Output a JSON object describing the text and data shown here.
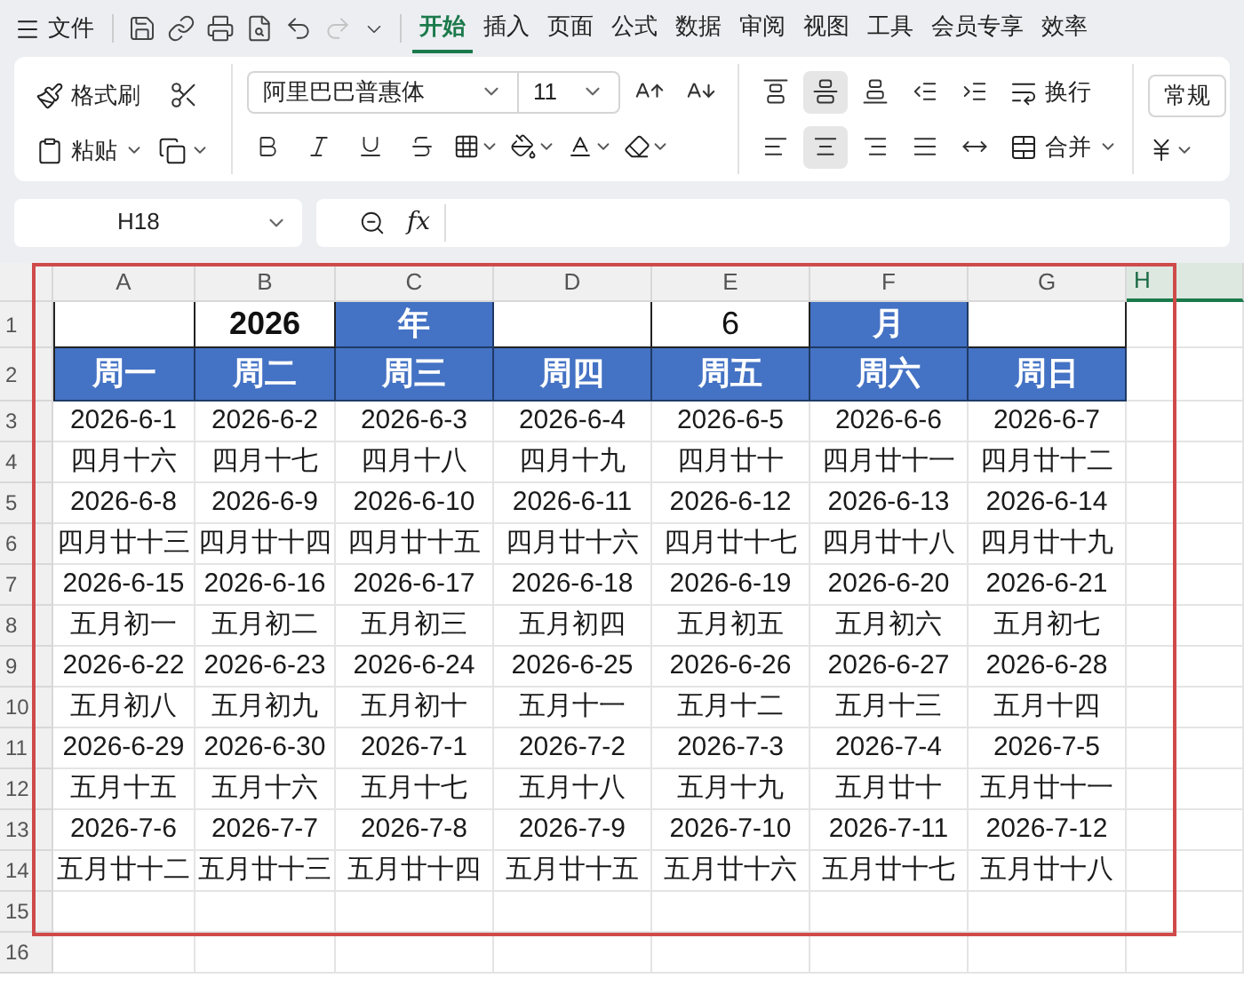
{
  "menu_bar": {
    "file_label": "文件",
    "quick_access": [
      {
        "kind": "save",
        "disabled": false
      },
      {
        "kind": "link",
        "disabled": false
      },
      {
        "kind": "print",
        "disabled": false
      },
      {
        "kind": "preview",
        "disabled": false
      },
      {
        "kind": "undo",
        "disabled": false
      },
      {
        "kind": "redo",
        "disabled": true
      },
      {
        "kind": "more",
        "disabled": false
      }
    ],
    "tabs": [
      {
        "label": "开始",
        "selected": true
      },
      {
        "label": "插入",
        "selected": false
      },
      {
        "label": "页面",
        "selected": false
      },
      {
        "label": "公式",
        "selected": false
      },
      {
        "label": "数据",
        "selected": false
      },
      {
        "label": "审阅",
        "selected": false
      },
      {
        "label": "视图",
        "selected": false
      },
      {
        "label": "工具",
        "selected": false
      },
      {
        "label": "会员专享",
        "selected": false
      },
      {
        "label": "效率",
        "selected": false
      }
    ]
  },
  "ribbon": {
    "format_painter": "格式刷",
    "paste": "粘贴",
    "font_name": "阿里巴巴普惠体",
    "font_size": "11",
    "wrap": "换行",
    "merge": "合并",
    "number_format": "常规",
    "vertical_align": [
      {
        "kind": "top",
        "selected": false
      },
      {
        "kind": "middle",
        "selected": true
      },
      {
        "kind": "bottom",
        "selected": false
      },
      {
        "kind": "outdent",
        "selected": false
      },
      {
        "kind": "indent",
        "selected": false
      }
    ],
    "horizontal_align": [
      {
        "kind": "left",
        "selected": false
      },
      {
        "kind": "center",
        "selected": true
      },
      {
        "kind": "right",
        "selected": false
      },
      {
        "kind": "justify",
        "selected": false
      },
      {
        "kind": "distributed",
        "selected": false
      }
    ]
  },
  "formula_bar": {
    "cell_ref": "H18",
    "fx": "fx"
  },
  "sheet": {
    "columns": [
      {
        "label": "A",
        "selected": false
      },
      {
        "label": "B",
        "selected": false
      },
      {
        "label": "C",
        "selected": false
      },
      {
        "label": "D",
        "selected": false
      },
      {
        "label": "E",
        "selected": false
      },
      {
        "label": "F",
        "selected": false
      },
      {
        "label": "G",
        "selected": false
      },
      {
        "label": "H",
        "selected": true
      }
    ],
    "row_numbers": [
      "1",
      "2",
      "3",
      "4",
      "5",
      "6",
      "7",
      "8",
      "9",
      "10",
      "11",
      "12",
      "13",
      "14",
      "15",
      "16"
    ],
    "rows": [
      [
        {
          "kind": "input"
        },
        {
          "kind": "input",
          "text": "2026",
          "bold": true
        },
        {
          "kind": "header",
          "text": "年"
        },
        {
          "kind": "input"
        },
        {
          "kind": "input",
          "text": "6",
          "bold": false
        },
        {
          "kind": "header",
          "text": "月"
        },
        {
          "kind": "input"
        }
      ],
      [
        {
          "kind": "header",
          "text": "周一"
        },
        {
          "kind": "header",
          "text": "周二"
        },
        {
          "kind": "header",
          "text": "周三"
        },
        {
          "kind": "header",
          "text": "周四"
        },
        {
          "kind": "header",
          "text": "周五"
        },
        {
          "kind": "header",
          "text": "周六"
        },
        {
          "kind": "header",
          "text": "周日"
        }
      ],
      [
        {
          "kind": "plain",
          "text": "2026-6-1"
        },
        {
          "kind": "plain",
          "text": "2026-6-2"
        },
        {
          "kind": "plain",
          "text": "2026-6-3"
        },
        {
          "kind": "plain",
          "text": "2026-6-4"
        },
        {
          "kind": "plain",
          "text": "2026-6-5"
        },
        {
          "kind": "plain",
          "text": "2026-6-6"
        },
        {
          "kind": "plain",
          "text": "2026-6-7"
        }
      ],
      [
        {
          "kind": "plain",
          "text": "四月十六"
        },
        {
          "kind": "plain",
          "text": "四月十七"
        },
        {
          "kind": "plain",
          "text": "四月十八"
        },
        {
          "kind": "plain",
          "text": "四月十九"
        },
        {
          "kind": "plain",
          "text": "四月廿十"
        },
        {
          "kind": "plain",
          "text": "四月廿十一"
        },
        {
          "kind": "plain",
          "text": "四月廿十二"
        }
      ],
      [
        {
          "kind": "plain",
          "text": "2026-6-8"
        },
        {
          "kind": "plain",
          "text": "2026-6-9"
        },
        {
          "kind": "plain",
          "text": "2026-6-10"
        },
        {
          "kind": "plain",
          "text": "2026-6-11"
        },
        {
          "kind": "plain",
          "text": "2026-6-12"
        },
        {
          "kind": "plain",
          "text": "2026-6-13"
        },
        {
          "kind": "plain",
          "text": "2026-6-14"
        }
      ],
      [
        {
          "kind": "plain",
          "text": "四月廿十三"
        },
        {
          "kind": "plain",
          "text": "四月廿十四"
        },
        {
          "kind": "plain",
          "text": "四月廿十五"
        },
        {
          "kind": "plain",
          "text": "四月廿十六"
        },
        {
          "kind": "plain",
          "text": "四月廿十七"
        },
        {
          "kind": "plain",
          "text": "四月廿十八"
        },
        {
          "kind": "plain",
          "text": "四月廿十九"
        }
      ],
      [
        {
          "kind": "plain",
          "text": "2026-6-15"
        },
        {
          "kind": "plain",
          "text": "2026-6-16"
        },
        {
          "kind": "plain",
          "text": "2026-6-17"
        },
        {
          "kind": "plain",
          "text": "2026-6-18"
        },
        {
          "kind": "plain",
          "text": "2026-6-19"
        },
        {
          "kind": "plain",
          "text": "2026-6-20"
        },
        {
          "kind": "plain",
          "text": "2026-6-21"
        }
      ],
      [
        {
          "kind": "plain",
          "text": "五月初一"
        },
        {
          "kind": "plain",
          "text": "五月初二"
        },
        {
          "kind": "plain",
          "text": "五月初三"
        },
        {
          "kind": "plain",
          "text": "五月初四"
        },
        {
          "kind": "plain",
          "text": "五月初五"
        },
        {
          "kind": "plain",
          "text": "五月初六"
        },
        {
          "kind": "plain",
          "text": "五月初七"
        }
      ],
      [
        {
          "kind": "plain",
          "text": "2026-6-22"
        },
        {
          "kind": "plain",
          "text": "2026-6-23"
        },
        {
          "kind": "plain",
          "text": "2026-6-24"
        },
        {
          "kind": "plain",
          "text": "2026-6-25"
        },
        {
          "kind": "plain",
          "text": "2026-6-26"
        },
        {
          "kind": "plain",
          "text": "2026-6-27"
        },
        {
          "kind": "plain",
          "text": "2026-6-28"
        }
      ],
      [
        {
          "kind": "plain",
          "text": "五月初八"
        },
        {
          "kind": "plain",
          "text": "五月初九"
        },
        {
          "kind": "plain",
          "text": "五月初十"
        },
        {
          "kind": "plain",
          "text": "五月十一"
        },
        {
          "kind": "plain",
          "text": "五月十二"
        },
        {
          "kind": "plain",
          "text": "五月十三"
        },
        {
          "kind": "plain",
          "text": "五月十四"
        }
      ],
      [
        {
          "kind": "plain",
          "text": "2026-6-29"
        },
        {
          "kind": "plain",
          "text": "2026-6-30"
        },
        {
          "kind": "plain",
          "text": "2026-7-1"
        },
        {
          "kind": "plain",
          "text": "2026-7-2"
        },
        {
          "kind": "plain",
          "text": "2026-7-3"
        },
        {
          "kind": "plain",
          "text": "2026-7-4"
        },
        {
          "kind": "plain",
          "text": "2026-7-5"
        }
      ],
      [
        {
          "kind": "plain",
          "text": "五月十五"
        },
        {
          "kind": "plain",
          "text": "五月十六"
        },
        {
          "kind": "plain",
          "text": "五月十七"
        },
        {
          "kind": "plain",
          "text": "五月十八"
        },
        {
          "kind": "plain",
          "text": "五月十九"
        },
        {
          "kind": "plain",
          "text": "五月廿十"
        },
        {
          "kind": "plain",
          "text": "五月廿十一"
        }
      ],
      [
        {
          "kind": "plain",
          "text": "2026-7-6"
        },
        {
          "kind": "plain",
          "text": "2026-7-7"
        },
        {
          "kind": "plain",
          "text": "2026-7-8"
        },
        {
          "kind": "plain",
          "text": "2026-7-9"
        },
        {
          "kind": "plain",
          "text": "2026-7-10"
        },
        {
          "kind": "plain",
          "text": "2026-7-11"
        },
        {
          "kind": "plain",
          "text": "2026-7-12"
        }
      ],
      [
        {
          "kind": "plain",
          "text": "五月廿十二"
        },
        {
          "kind": "plain",
          "text": "五月廿十三"
        },
        {
          "kind": "plain",
          "text": "五月廿十四"
        },
        {
          "kind": "plain",
          "text": "五月廿十五"
        },
        {
          "kind": "plain",
          "text": "五月廿十六"
        },
        {
          "kind": "plain",
          "text": "五月廿十七"
        },
        {
          "kind": "plain",
          "text": "五月廿十八"
        }
      ]
    ]
  }
}
